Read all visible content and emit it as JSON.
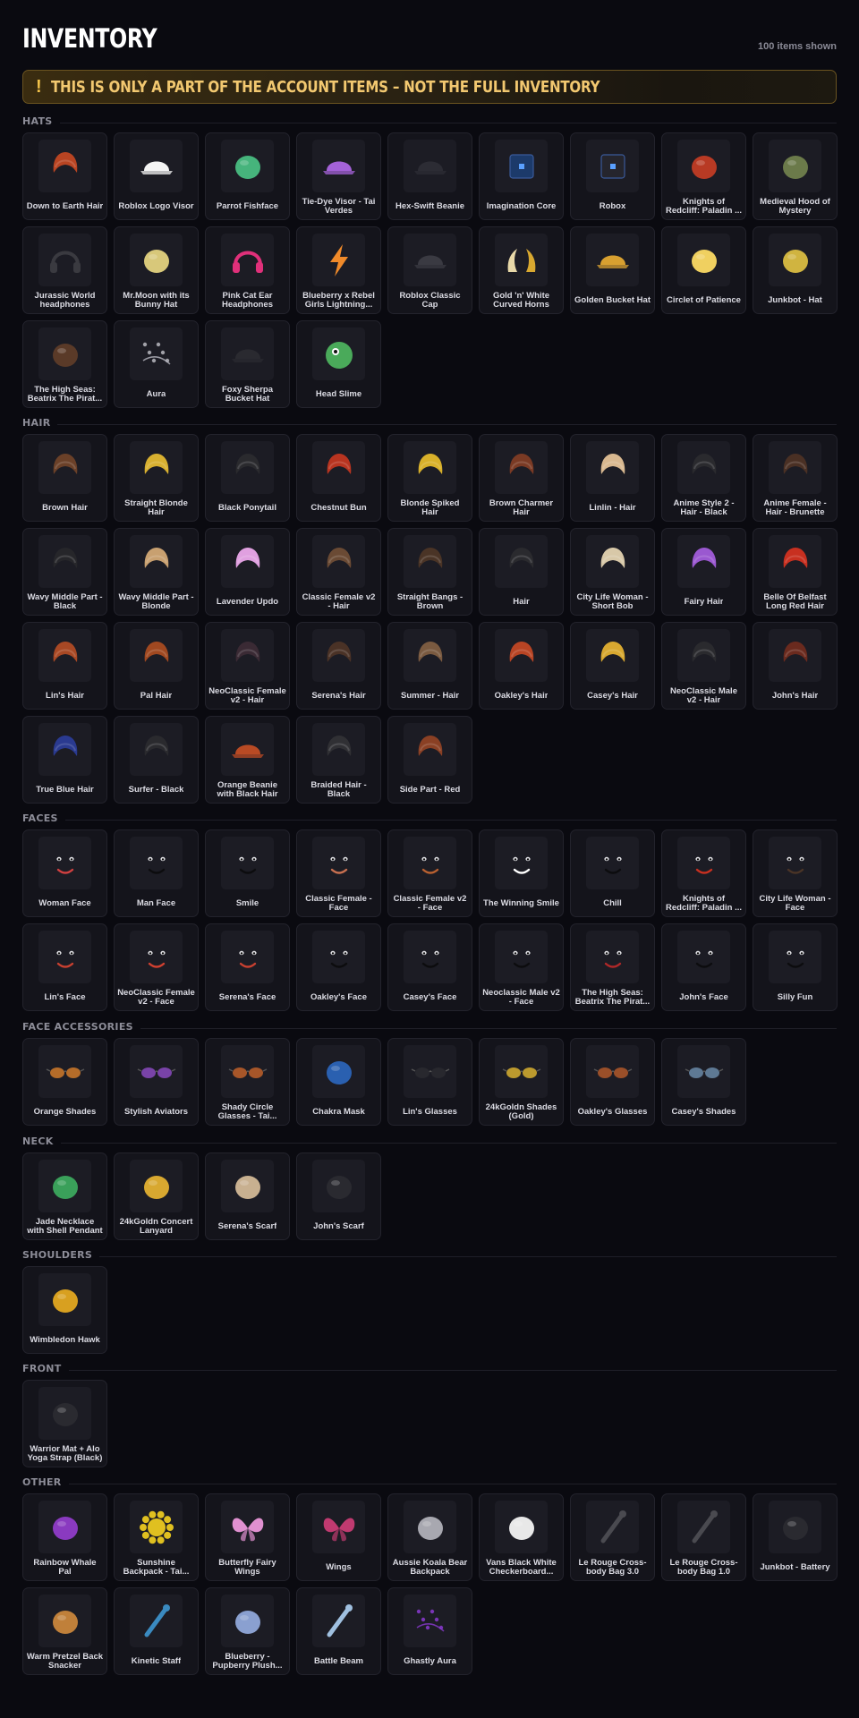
{
  "title": "INVENTORY",
  "count_label": "100 items shown",
  "warning": {
    "icon": "!",
    "text": "THIS IS ONLY A PART OF THE ACCOUNT ITEMS – NOT THE FULL INVENTORY"
  },
  "colors": {
    "background": "#0a0a10",
    "warning_text": "#f2c870",
    "warning_border": "#6a5320",
    "card": "#14141b"
  },
  "sections": [
    {
      "id": "hats",
      "title": "HATS",
      "items": [
        {
          "name": "Down to Earth Hair",
          "icon": "hair-icon",
          "color": "#b84422"
        },
        {
          "name": "Roblox Logo Visor",
          "icon": "visor-icon",
          "color": "#f4f4f4"
        },
        {
          "name": "Parrot Fishface",
          "icon": "fish-icon",
          "color": "#46b47c"
        },
        {
          "name": "Tie-Dye Visor - Tai Verdes",
          "icon": "visor-icon",
          "color": "#a462d8"
        },
        {
          "name": "Hex-Swift Beanie",
          "icon": "beanie-icon",
          "color": "#2c2c34"
        },
        {
          "name": "Imagination Core",
          "icon": "cube-icon",
          "color": "#1c3a6a"
        },
        {
          "name": "Robox",
          "icon": "cube-icon",
          "color": "#25252d"
        },
        {
          "name": "Knights of Redcliff: Paladin ...",
          "icon": "helmet-icon",
          "color": "#b83a24"
        },
        {
          "name": "Medieval Hood of Mystery",
          "icon": "hood-icon",
          "color": "#6b7a4a"
        },
        {
          "name": "Jurassic World headphones",
          "icon": "headphones-icon",
          "color": "#3a3a40"
        },
        {
          "name": "Mr.Moon with its Bunny Hat",
          "icon": "moon-icon",
          "color": "#d8c87a"
        },
        {
          "name": "Pink Cat Ear Headphones",
          "icon": "headphones-icon",
          "color": "#e0307a"
        },
        {
          "name": "Blueberry x Rebel Girls Lightning...",
          "icon": "lightning-icon",
          "color": "#f08a2a"
        },
        {
          "name": "Roblox Classic Cap",
          "icon": "cap-icon",
          "color": "#3a3a42"
        },
        {
          "name": "Gold 'n' White Curved Horns",
          "icon": "horns-icon",
          "color": "#e8d8a8"
        },
        {
          "name": "Golden Bucket Hat",
          "icon": "bucket-hat-icon",
          "color": "#d8a030"
        },
        {
          "name": "Circlet of Patience",
          "icon": "circlet-icon",
          "color": "#f0d060"
        },
        {
          "name": "Junkbot - Hat",
          "icon": "robot-hat-icon",
          "color": "#d0b440"
        },
        {
          "name": "The High Seas: Beatrix The Pirat...",
          "icon": "pirate-hat-icon",
          "color": "#5a3a28"
        },
        {
          "name": "Aura",
          "icon": "aura-icon",
          "color": "#b8b8c0"
        },
        {
          "name": "Foxy Sherpa Bucket Hat",
          "icon": "bucket-hat-icon",
          "color": "#2a2a30"
        },
        {
          "name": "Head Slime",
          "icon": "slime-icon",
          "color": "#4aaa5a"
        }
      ]
    },
    {
      "id": "hair",
      "title": "HAIR",
      "items": [
        {
          "name": "Brown Hair",
          "icon": "hair-icon",
          "color": "#6a4028"
        },
        {
          "name": "Straight Blonde Hair",
          "icon": "hair-icon",
          "color": "#d8b030"
        },
        {
          "name": "Black Ponytail",
          "icon": "hair-icon",
          "color": "#2a2a2e"
        },
        {
          "name": "Chestnut Bun",
          "icon": "hair-icon",
          "color": "#b83420"
        },
        {
          "name": "Blonde Spiked Hair",
          "icon": "hair-icon",
          "color": "#d8b02a"
        },
        {
          "name": "Brown Charmer Hair",
          "icon": "hair-icon",
          "color": "#7a3a24"
        },
        {
          "name": "Linlin - Hair",
          "icon": "hair-icon",
          "color": "#d8b890"
        },
        {
          "name": "Anime Style 2 - Hair - Black",
          "icon": "hair-icon",
          "color": "#2a2a2e"
        },
        {
          "name": "Anime Female - Hair - Brunette",
          "icon": "hair-icon",
          "color": "#4a3024"
        },
        {
          "name": "Wavy Middle Part - Black",
          "icon": "hair-icon",
          "color": "#26262a"
        },
        {
          "name": "Wavy Middle Part - Blonde",
          "icon": "hair-icon",
          "color": "#c8a070"
        },
        {
          "name": "Lavender Updo",
          "icon": "hair-icon",
          "color": "#e0a0e0"
        },
        {
          "name": "Classic Female v2 - Hair",
          "icon": "hair-icon",
          "color": "#6a4a34"
        },
        {
          "name": "Straight Bangs - Brown",
          "icon": "hair-icon",
          "color": "#4a3426"
        },
        {
          "name": "Hair",
          "icon": "hair-icon",
          "color": "#2a2a2e"
        },
        {
          "name": "City Life Woman - Short Bob",
          "icon": "hair-icon",
          "color": "#d8c8a8"
        },
        {
          "name": "Fairy Hair",
          "icon": "hair-icon",
          "color": "#9a58d0"
        },
        {
          "name": "Belle Of Belfast Long Red Hair",
          "icon": "hair-icon",
          "color": "#c83020"
        },
        {
          "name": "Lin's Hair",
          "icon": "hair-icon",
          "color": "#a84824"
        },
        {
          "name": "Pal Hair",
          "icon": "hair-icon",
          "color": "#a04820"
        },
        {
          "name": "NeoClassic Female v2 - Hair",
          "icon": "hair-icon",
          "color": "#3a2a34"
        },
        {
          "name": "Serena's Hair",
          "icon": "hair-icon",
          "color": "#4a3226"
        },
        {
          "name": "Summer - Hair",
          "icon": "hair-icon",
          "color": "#7a5a40"
        },
        {
          "name": "Oakley's Hair",
          "icon": "hair-icon",
          "color": "#b84424"
        },
        {
          "name": "Casey's Hair",
          "icon": "hair-icon",
          "color": "#d8a830"
        },
        {
          "name": "NeoClassic Male v2 - Hair",
          "icon": "hair-icon",
          "color": "#2a2a2e"
        },
        {
          "name": "John's Hair",
          "icon": "hair-icon",
          "color": "#6a2a1e"
        },
        {
          "name": "True Blue Hair",
          "icon": "hair-icon",
          "color": "#2a3a90"
        },
        {
          "name": "Surfer - Black",
          "icon": "hair-icon",
          "color": "#2a2a2e"
        },
        {
          "name": "Orange Beanie with Black Hair",
          "icon": "beanie-icon",
          "color": "#b84a24"
        },
        {
          "name": "Braided Hair - Black",
          "icon": "hair-icon",
          "color": "#303034"
        },
        {
          "name": "Side Part - Red",
          "icon": "hair-icon",
          "color": "#8a4024"
        }
      ]
    },
    {
      "id": "faces",
      "title": "FACES",
      "items": [
        {
          "name": "Woman Face",
          "icon": "face-icon",
          "color": "#d04040"
        },
        {
          "name": "Man Face",
          "icon": "face-icon",
          "color": "#202024"
        },
        {
          "name": "Smile",
          "icon": "face-icon",
          "color": "#202024"
        },
        {
          "name": "Classic Female - Face",
          "icon": "face-icon",
          "color": "#c87050"
        },
        {
          "name": "Classic Female v2 - Face",
          "icon": "face-icon",
          "color": "#b86030"
        },
        {
          "name": "The Winning Smile",
          "icon": "face-icon",
          "color": "#ffffff"
        },
        {
          "name": "Chill",
          "icon": "face-icon",
          "color": "#202024"
        },
        {
          "name": "Knights of Redcliff: Paladin ...",
          "icon": "face-icon",
          "color": "#c83020"
        },
        {
          "name": "City Life Woman - Face",
          "icon": "face-icon",
          "color": "#4a3426"
        },
        {
          "name": "Lin's Face",
          "icon": "face-icon",
          "color": "#c84030"
        },
        {
          "name": "NeoClassic Female v2 - Face",
          "icon": "face-icon",
          "color": "#d04030"
        },
        {
          "name": "Serena's Face",
          "icon": "face-icon",
          "color": "#c84030"
        },
        {
          "name": "Oakley's Face",
          "icon": "face-icon",
          "color": "#202024"
        },
        {
          "name": "Casey's Face",
          "icon": "face-icon",
          "color": "#202024"
        },
        {
          "name": "Neoclassic Male v2 - Face",
          "icon": "face-icon",
          "color": "#202024"
        },
        {
          "name": "The High Seas: Beatrix The Pirat...",
          "icon": "face-icon",
          "color": "#b02828"
        },
        {
          "name": "John's Face",
          "icon": "face-icon",
          "color": "#202024"
        },
        {
          "name": "Silly Fun",
          "icon": "face-icon",
          "color": "#202024"
        }
      ]
    },
    {
      "id": "face_accessories",
      "title": "FACE ACCESSORIES",
      "items": [
        {
          "name": "Orange Shades",
          "icon": "glasses-icon",
          "color": "#d07a2a"
        },
        {
          "name": "Stylish Aviators",
          "icon": "glasses-icon",
          "color": "#8a4ac0"
        },
        {
          "name": "Shady Circle Glasses - Tai...",
          "icon": "glasses-icon",
          "color": "#c0602a"
        },
        {
          "name": "Chakra Mask",
          "icon": "mask-icon",
          "color": "#2a60b0"
        },
        {
          "name": "Lin's Glasses",
          "icon": "glasses-icon",
          "color": "#2a2a30"
        },
        {
          "name": "24kGoldn Shades (Gold)",
          "icon": "glasses-icon",
          "color": "#d8b030"
        },
        {
          "name": "Oakley's Glasses",
          "icon": "glasses-icon",
          "color": "#b0582a"
        },
        {
          "name": "Casey's Shades",
          "icon": "glasses-icon",
          "color": "#6a8aa8"
        }
      ]
    },
    {
      "id": "neck",
      "title": "NECK",
      "items": [
        {
          "name": "Jade Necklace with Shell Pendant",
          "icon": "necklace-icon",
          "color": "#3aa05a"
        },
        {
          "name": "24kGoldn Concert Lanyard",
          "icon": "lanyard-icon",
          "color": "#d8a830"
        },
        {
          "name": "Serena's Scarf",
          "icon": "scarf-icon",
          "color": "#c8b090"
        },
        {
          "name": "John's Scarf",
          "icon": "scarf-icon",
          "color": "#2a2a30"
        }
      ]
    },
    {
      "id": "shoulders",
      "title": "SHOULDERS",
      "items": [
        {
          "name": "Wimbledon Hawk",
          "icon": "bird-icon",
          "color": "#d8a020"
        }
      ]
    },
    {
      "id": "front",
      "title": "FRONT",
      "items": [
        {
          "name": "Warrior Mat + Alo Yoga Strap (Black)",
          "icon": "strap-icon",
          "color": "#2a2a30"
        }
      ]
    },
    {
      "id": "other",
      "title": "OTHER",
      "items": [
        {
          "name": "Rainbow Whale Pal",
          "icon": "whale-icon",
          "color": "#8a3ac0"
        },
        {
          "name": "Sunshine Backpack - Tai...",
          "icon": "sun-icon",
          "color": "#e0c020"
        },
        {
          "name": "Butterfly Fairy Wings",
          "icon": "wings-icon",
          "color": "#e090d0"
        },
        {
          "name": "Wings",
          "icon": "wings-icon",
          "color": "#c03a70"
        },
        {
          "name": "Aussie Koala Bear Backpack",
          "icon": "koala-icon",
          "color": "#a8a8b0"
        },
        {
          "name": "Vans Black White Checkerboard...",
          "icon": "umbrella-icon",
          "color": "#e8e8e8"
        },
        {
          "name": "Le Rouge Cross-body Bag 3.0",
          "icon": "bag-icon",
          "color": "#4a4a50"
        },
        {
          "name": "Le Rouge Cross-body Bag 1.0",
          "icon": "bag-icon",
          "color": "#4a4a50"
        },
        {
          "name": "Junkbot - Battery",
          "icon": "battery-icon",
          "color": "#2a2a30"
        },
        {
          "name": "Warm Pretzel Back Snacker",
          "icon": "pretzel-icon",
          "color": "#c0803a"
        },
        {
          "name": "Kinetic Staff",
          "icon": "staff-icon",
          "color": "#3a8ac0"
        },
        {
          "name": "Blueberry - Pupberry Plush...",
          "icon": "plush-icon",
          "color": "#8aa0d0"
        },
        {
          "name": "Battle Beam",
          "icon": "beam-icon",
          "color": "#a0c0e0"
        },
        {
          "name": "Ghastly Aura",
          "icon": "aura-icon",
          "color": "#8a3ad0"
        }
      ]
    }
  ]
}
